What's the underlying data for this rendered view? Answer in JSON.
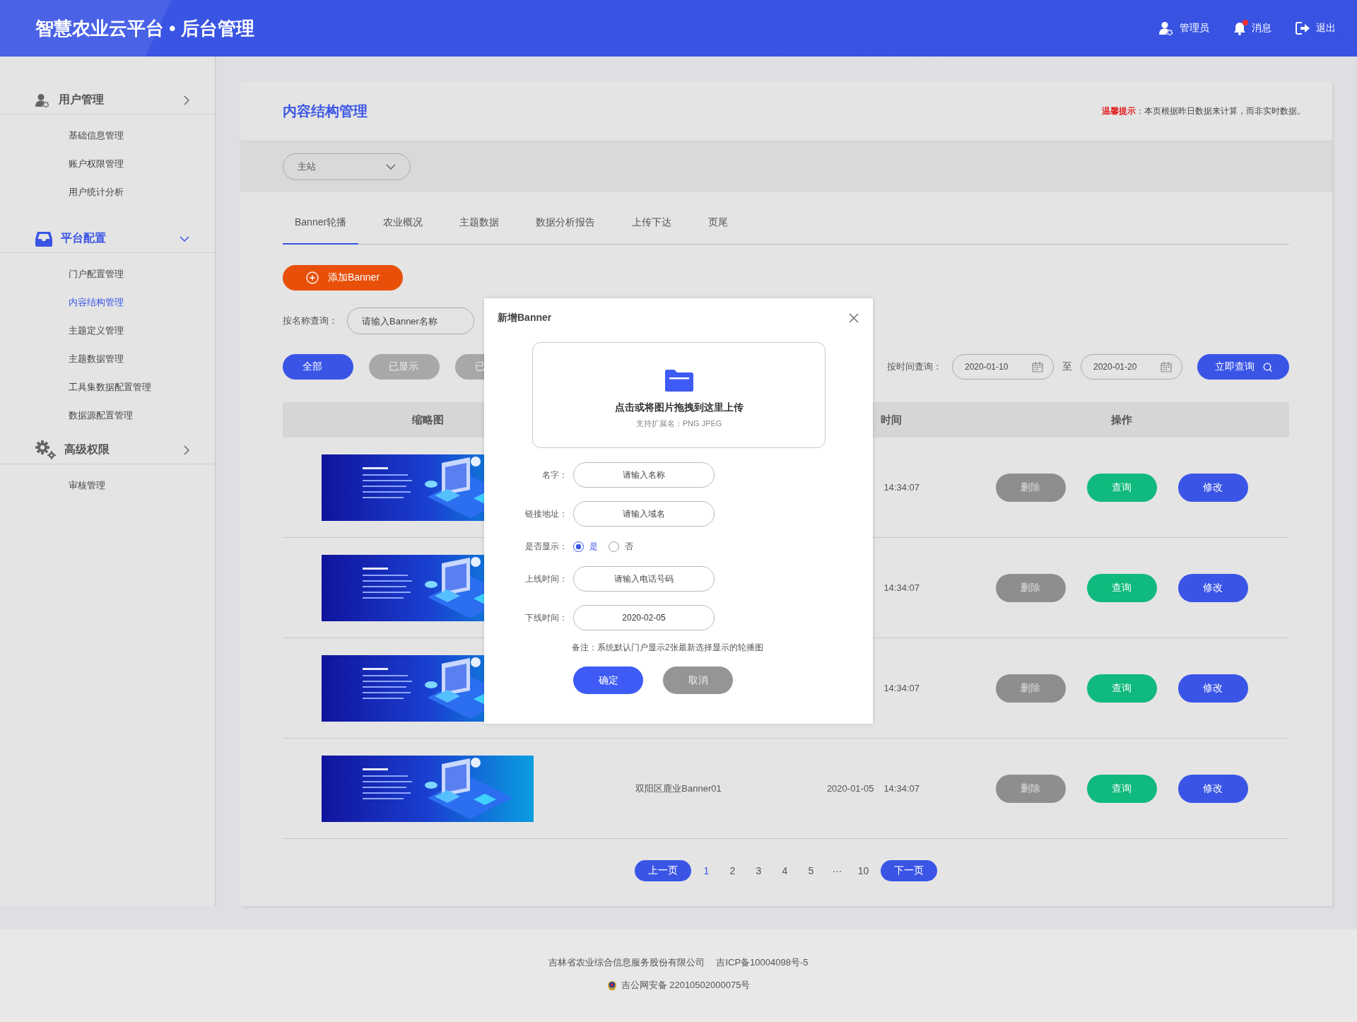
{
  "header": {
    "title": "智慧农业云平台 • 后台管理",
    "actions": [
      {
        "kind": "user",
        "label": "管理员",
        "unread": false
      },
      {
        "kind": "bell",
        "label": "消息",
        "unread": true
      },
      {
        "kind": "exit",
        "label": "退出",
        "unread": false
      }
    ]
  },
  "sidebar": {
    "groups": [
      {
        "kind": "user",
        "label": "用户管理",
        "selected": false,
        "items": [
          {
            "label": "基础信息管理",
            "selected": false
          },
          {
            "label": "账户权限管理",
            "selected": false
          },
          {
            "label": "用户统计分析",
            "selected": false
          }
        ]
      },
      {
        "kind": "tray",
        "label": "平台配置",
        "selected": true,
        "items": [
          {
            "label": "门户配置管理",
            "selected": false
          },
          {
            "label": "内容结构管理",
            "selected": true
          },
          {
            "label": "主题定义管理",
            "selected": false
          },
          {
            "label": "主题数据管理",
            "selected": false
          },
          {
            "label": "工具集数据配置管理",
            "selected": false
          },
          {
            "label": "数据源配置管理",
            "selected": false
          }
        ]
      },
      {
        "kind": "gears",
        "label": "高级权限",
        "selected": false,
        "items": [
          {
            "label": "审核管理",
            "selected": false
          }
        ]
      }
    ]
  },
  "page": {
    "title": "内容结构管理",
    "tip_label": "温馨提示",
    "tip_text": "：本页根据昨日数据来计算，而非实时数据。"
  },
  "site_select": {
    "value": "主站"
  },
  "tabs": [
    {
      "label": "Banner轮播",
      "selected": true
    },
    {
      "label": "农业概况",
      "selected": false
    },
    {
      "label": "主题数据",
      "selected": false
    },
    {
      "label": "数据分析报告",
      "selected": false
    },
    {
      "label": "上传下达",
      "selected": false
    },
    {
      "label": "页尾",
      "selected": false
    }
  ],
  "add_button": "添加Banner",
  "name_search": {
    "label": "按名称查询：",
    "placeholder": "请输入Banner名称"
  },
  "filters": [
    {
      "label": "全部",
      "selected": true
    },
    {
      "label": "已显示",
      "selected": false
    },
    {
      "label": "已",
      "selected": false
    }
  ],
  "time_search": {
    "label": "按时间查询：",
    "from": "2020-01-10",
    "separator": "至",
    "to": "2020-01-20",
    "button": "立即查询"
  },
  "table": {
    "columns": {
      "thumbnail": "缩略图",
      "time": "时间",
      "actions": "操作"
    },
    "rows": [
      {
        "thumbnail": {
          "kind": "picture"
        },
        "time": "14:34:07",
        "actions": [
          {
            "kind": "delete",
            "label": "删除"
          },
          {
            "kind": "query",
            "label": "查询"
          },
          {
            "kind": "edit",
            "label": "修改"
          }
        ]
      },
      {
        "thumbnail": {
          "kind": "picture"
        },
        "time": "14:34:07",
        "actions": [
          {
            "kind": "delete",
            "label": "删除"
          },
          {
            "kind": "query",
            "label": "查询"
          },
          {
            "kind": "edit",
            "label": "修改"
          }
        ]
      },
      {
        "thumbnail": {
          "kind": "picture"
        },
        "time": "14:34:07",
        "actions": [
          {
            "kind": "delete",
            "label": "删除"
          },
          {
            "kind": "query",
            "label": "查询"
          },
          {
            "kind": "edit",
            "label": "修改"
          }
        ]
      },
      {
        "thumbnail": {
          "kind": "picture"
        },
        "name": "双阳区鹿业Banner01",
        "date": "2020-01-05",
        "time": "14:34:07",
        "actions": [
          {
            "kind": "delete",
            "label": "删除"
          },
          {
            "kind": "query",
            "label": "查询"
          },
          {
            "kind": "edit",
            "label": "修改"
          }
        ]
      }
    ]
  },
  "pagination": {
    "prev": "上一页",
    "next": "下一页",
    "pages": [
      {
        "label": "1",
        "selected": true
      },
      {
        "label": "2",
        "selected": false
      },
      {
        "label": "3",
        "selected": false
      },
      {
        "label": "4",
        "selected": false
      },
      {
        "label": "5",
        "selected": false
      },
      {
        "label": "···",
        "selected": false
      },
      {
        "label": "10",
        "selected": false
      }
    ]
  },
  "modal": {
    "title": "新增Banner",
    "upload": {
      "title": "点击或将图片拖拽到这里上传",
      "hint": "支持扩展名：PNG  JPEG"
    },
    "fields": [
      {
        "kind": "text",
        "label": "名字：",
        "placeholder": "请输入名称"
      },
      {
        "kind": "text",
        "label": "链接地址：",
        "placeholder": "请输入域名"
      },
      {
        "kind": "radio",
        "label": "是否显示：",
        "options": [
          {
            "label": "是",
            "selected": true
          },
          {
            "label": "否",
            "selected": false
          }
        ]
      },
      {
        "kind": "text",
        "label": "上线时间：",
        "placeholder": "请输入电话号码"
      },
      {
        "kind": "text",
        "label": "下线时间：",
        "value": "2020-02-05"
      }
    ],
    "note": "备注：系统默认门户显示2张最新选择显示的轮播图",
    "buttons": [
      {
        "kind": "primary",
        "label": "确定"
      },
      {
        "kind": "secondary",
        "label": "取消"
      }
    ]
  },
  "footer": {
    "lines": [
      {
        "kind": "plain",
        "texts": [
          "吉林省农业综合信息服务股份有限公司",
          "吉ICP备10004098号-5"
        ]
      },
      {
        "kind": "emblem",
        "texts": [
          "吉公网安备 22010502000075号"
        ]
      }
    ]
  }
}
